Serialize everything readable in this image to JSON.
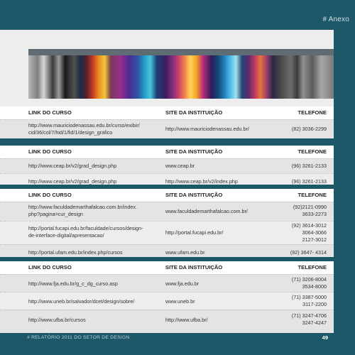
{
  "header": {
    "label": "# Anexo"
  },
  "columns": {
    "course": "LINK DO CURSO",
    "institution": "SITE DA INSTITUIÇÃO",
    "phone": "TELEFONE"
  },
  "tables": [
    {
      "rows": [
        {
          "course": "http://www.mauriciodenassau.edu.br/curso/exibir/\ncid/36/col/7/hid/1/fid/1/design_grafico",
          "institution": "http://www.mauriciodenassau.edu.br/",
          "phone": "(82) 3036-2299"
        }
      ]
    },
    {
      "rows": [
        {
          "course": "http://www.ceap.br/v2/grad_design.php",
          "institution": "www.ceap.br",
          "phone": "(96) 3261-2133"
        },
        {
          "course": "http://www.ceap.br/v2/grad_design.php",
          "institution": "http://www.ceap.br/v2/index.php",
          "phone": "(96) 3261-2133"
        }
      ]
    },
    {
      "rows": [
        {
          "course": "http://www.faculdademarthafalcao.com.br/index.\nphp?pagina=cur_design",
          "institution": "www.faculdademarthafalcao.com.br/",
          "phone": "(92)2121-0990\n3633-2273"
        },
        {
          "course": "http://portal.fucapi.edu.br/faculdade/cursos/design-\nde-interface-digital/apresentacao/",
          "institution": "http://portal.fucapi.edu.br/",
          "phone": "(92) 3614-3012\n3064-3066\n2127-3012"
        },
        {
          "course": "http://portal.ufam.edu.br/index.php/cursos",
          "institution": "www.ufam.edu.br",
          "phone": "(92) 3647- 4314"
        }
      ]
    },
    {
      "rows": [
        {
          "course": "http://www.fja.edu.br/g_c_dg_curso.asp",
          "institution": "www.fja.edu.br",
          "phone": "(71) 3206-8004\n3534-8000"
        },
        {
          "course": "http://www.uneb.br/salvador/dcet/design/sobre/",
          "institution": "www.uneb.br",
          "phone": "(71) 3387-5000\n3117-2200"
        },
        {
          "course": "http://www.ufba.br/cursos",
          "institution": "http://www.ufba.br/",
          "phone": "(71) 3247-4706\n3247-4247"
        }
      ]
    }
  ],
  "footer": {
    "text": "# RELATÓRIO 2011 DO SETOR DE DESIGN",
    "page": "49"
  }
}
